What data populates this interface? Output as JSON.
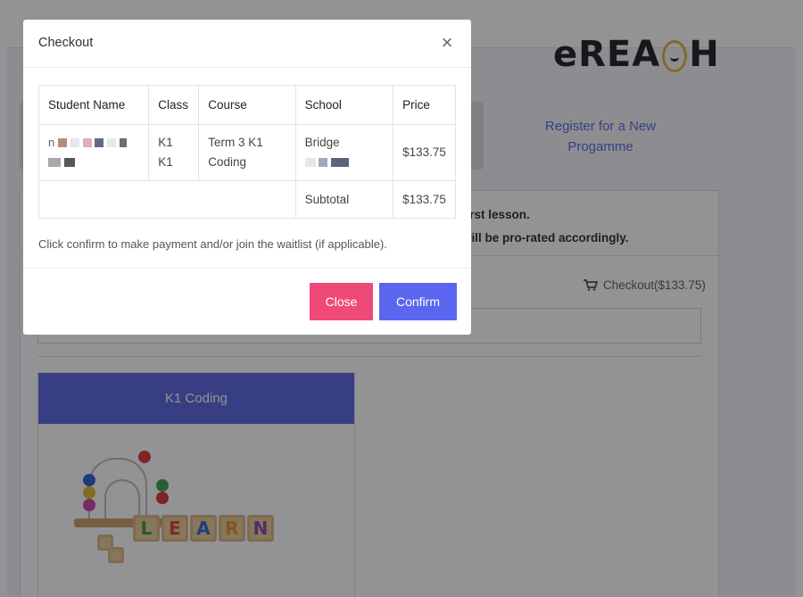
{
  "background": {
    "logo_text": "eREACH",
    "register_link": "Register for a New Progamme",
    "notice_line_1": "first lesson.",
    "notice_line_2": "will be pro-rated accordingly.",
    "checkout_link": "Checkout($133.75)",
    "course_card": {
      "title": "K1 Coding",
      "image_letters": [
        "L",
        "E",
        "A",
        "R",
        "N"
      ],
      "letter_colors": [
        "#2e8b3e",
        "#d9342c",
        "#1f5fc7",
        "#e58a1f",
        "#7a3fa8"
      ]
    }
  },
  "modal": {
    "title": "Checkout",
    "close_glyph": "×",
    "table": {
      "headers": [
        "Student Name",
        "Class",
        "Course",
        "School",
        "Price"
      ],
      "row": {
        "student_name": "",
        "class": "K1 K1",
        "course": "Term 3 K1 Coding",
        "school": "Bridge",
        "price": "$133.75"
      },
      "subtotal_label": "Subtotal",
      "subtotal_value": "$133.75"
    },
    "note": "Click confirm to make payment and/or join the waitlist (if applicable).",
    "close_button": "Close",
    "confirm_button": "Confirm"
  },
  "colors": {
    "accent": "#5b66ee",
    "danger": "#ef4a77",
    "card_header": "#4f5fd9"
  }
}
